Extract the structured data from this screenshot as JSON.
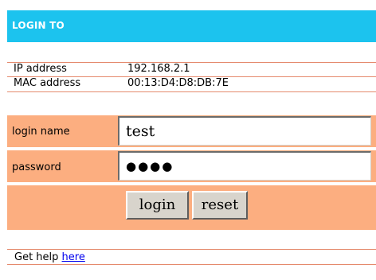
{
  "header": {
    "title": "LOGIN TO"
  },
  "device_info": {
    "ip_label": "IP address",
    "ip_value": "192.168.2.1",
    "mac_label": "MAC address",
    "mac_value": "00:13:D4:D8:DB:7E"
  },
  "form": {
    "login_name_label": "login name",
    "login_name_value": "test",
    "password_label": "password",
    "password_masked": "●●●●",
    "login_button": "login",
    "reset_button": "reset"
  },
  "help": {
    "prefix": "Get help",
    "link": "here"
  },
  "colors": {
    "header_bg": "#1cc3ee",
    "form_row_bg": "#fcae80",
    "divider": "#e58a6d",
    "link": "#0000ee"
  }
}
